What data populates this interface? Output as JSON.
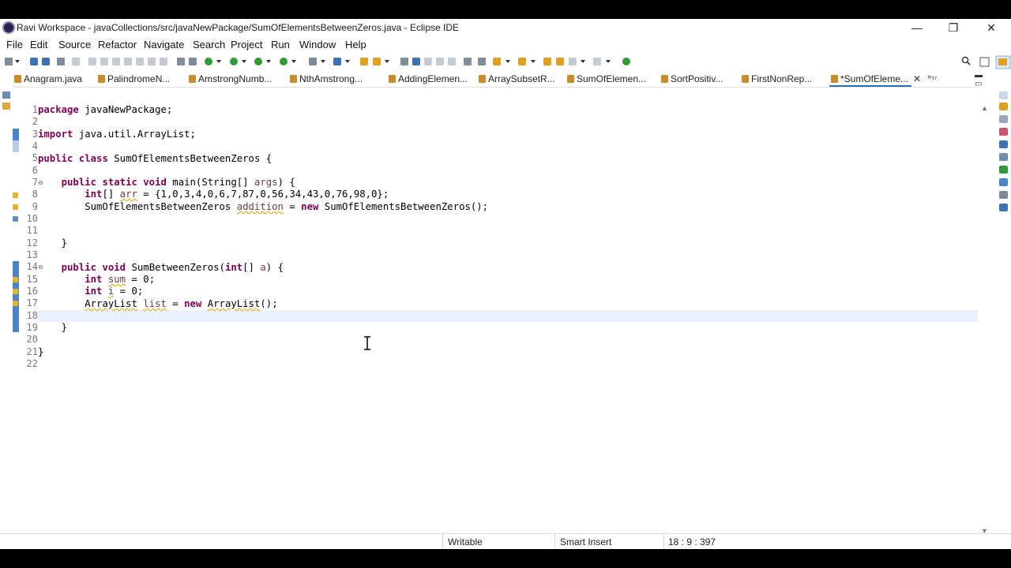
{
  "window": {
    "title": "Ravi Workspace - javaCollections/src/javaNewPackage/SumOfElementsBetweenZeros.java - Eclipse IDE",
    "minimize_glyph": "—",
    "maximize_glyph": "❐",
    "close_glyph": "✕"
  },
  "menu": {
    "items": [
      "File",
      "Edit",
      "Source",
      "Refactor",
      "Navigate",
      "Search",
      "Project",
      "Run",
      "Window",
      "Help"
    ]
  },
  "tabs": {
    "items": [
      {
        "label": "Anagram.java"
      },
      {
        "label": "PalindromeN..."
      },
      {
        "label": "AmstrongNumb..."
      },
      {
        "label": "NthAmstrong..."
      },
      {
        "label": "AddingElemen..."
      },
      {
        "label": "ArraySubsetR..."
      },
      {
        "label": "SumOfElemen..."
      },
      {
        "label": "SortPositiv..."
      },
      {
        "label": "FirstNonRep..."
      },
      {
        "label": "*SumOfEleme..."
      }
    ],
    "close_glyph": "✕",
    "overflow_label": "»₁₇",
    "active_index": 9
  },
  "editor": {
    "line_numbers": [
      "1",
      "2",
      "3",
      "4",
      "5",
      "6",
      "7",
      "8",
      "9",
      "10",
      "11",
      "12",
      "13",
      "14",
      "15",
      "16",
      "17",
      "18",
      "19",
      "20",
      "21",
      "22"
    ],
    "current_line": 18
  },
  "status": {
    "writable": "Writable",
    "insert_mode": "Smart Insert",
    "position": "18 : 9 : 397"
  },
  "colors": {
    "keyword": "#7f0055",
    "local_variable": "#6a3e3e",
    "current_line_bg": "#e8f2fe",
    "active_tab_accent": "#2d6fb5"
  },
  "icons": [
    "app-icon",
    "java-file-icon",
    "search-icon",
    "perspective-icon",
    "fold-icon",
    "warning-icon",
    "text-cursor-icon"
  ]
}
